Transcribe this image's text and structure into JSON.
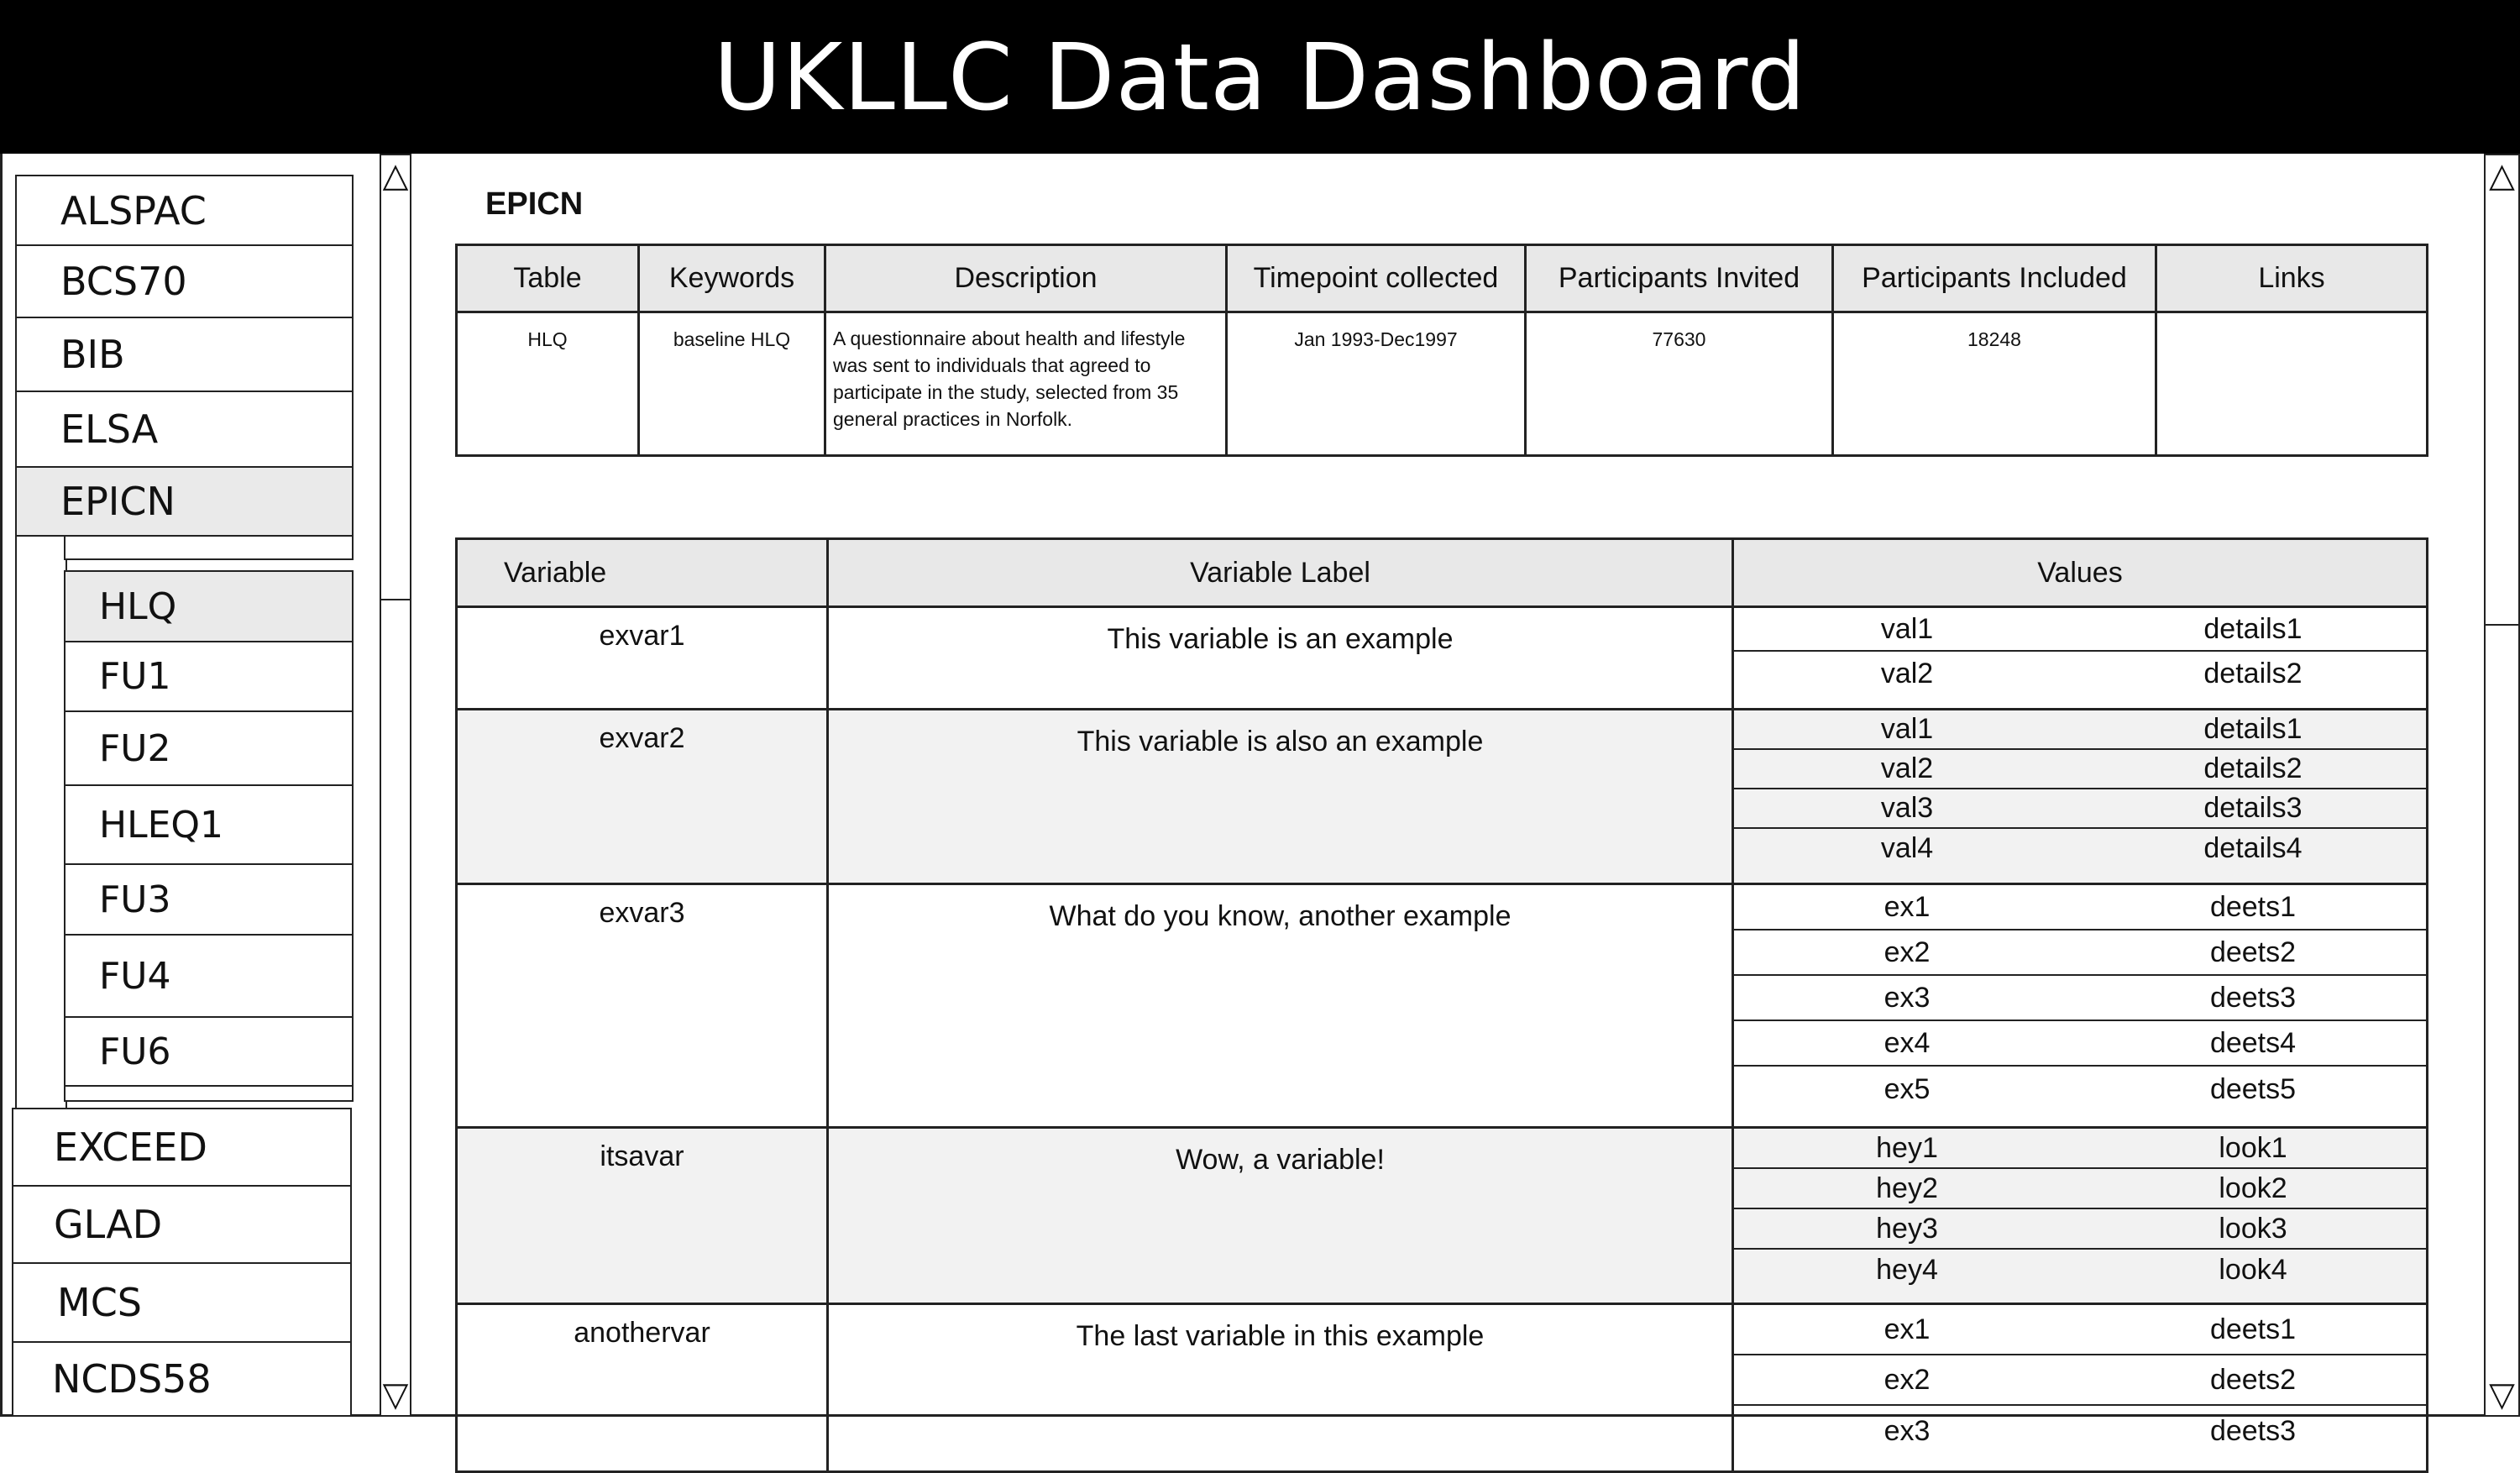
{
  "app": {
    "title": "UKLLC Data Dashboard"
  },
  "sidebar": {
    "studies": [
      "ALSPAC",
      "BCS70",
      "BIB",
      "ELSA",
      "EPICN",
      "EXCEED",
      "GLAD",
      "MCS",
      "NCDS58"
    ],
    "selected_study": "EPICN",
    "sub_items": [
      "HLQ",
      "FU1",
      "FU2",
      "HLEQ1",
      "FU3",
      "FU4",
      "FU6"
    ],
    "selected_sub_item": "HLQ"
  },
  "scroll_icons": {
    "up": "△",
    "down": "▽"
  },
  "main": {
    "title": "EPICN",
    "table_info": {
      "headers": [
        "Table",
        "Keywords",
        "Description",
        "Timepoint collected",
        "Participants Invited",
        "Participants Included",
        "Links"
      ],
      "row": {
        "table": "HLQ",
        "keywords": "baseline HLQ",
        "description": "A questionnaire about health and lifestyle was sent to individuals that agreed to participate in the study, selected from 35 general practices in Norfolk.",
        "timepoint": "Jan 1993-Dec1997",
        "invited": "77630",
        "included": "18248",
        "links": ""
      }
    },
    "variables": {
      "headers": [
        "Variable",
        "Variable Label",
        "Values"
      ],
      "rows": [
        {
          "variable": "exvar1",
          "label": "This variable is an example",
          "values": [
            [
              "val1",
              "details1"
            ],
            [
              "val2",
              "details2"
            ]
          ]
        },
        {
          "variable": "exvar2",
          "label": "This variable is also an example",
          "values": [
            [
              "val1",
              "details1"
            ],
            [
              "val2",
              "details2"
            ],
            [
              "val3",
              "details3"
            ],
            [
              "val4",
              "details4"
            ]
          ]
        },
        {
          "variable": "exvar3",
          "label": "What do you know, another example",
          "values": [
            [
              "ex1",
              "deets1"
            ],
            [
              "ex2",
              "deets2"
            ],
            [
              "ex3",
              "deets3"
            ],
            [
              "ex4",
              "deets4"
            ],
            [
              "ex5",
              "deets5"
            ]
          ]
        },
        {
          "variable": "itsavar",
          "label": "Wow, a variable!",
          "values": [
            [
              "hey1",
              "look1"
            ],
            [
              "hey2",
              "look2"
            ],
            [
              "hey3",
              "look3"
            ],
            [
              "hey4",
              "look4"
            ]
          ]
        },
        {
          "variable": "anothervar",
          "label": "The last variable in this example",
          "values": [
            [
              "ex1",
              "deets1"
            ],
            [
              "ex2",
              "deets2"
            ],
            [
              "ex3",
              "deets3"
            ]
          ]
        }
      ]
    }
  }
}
